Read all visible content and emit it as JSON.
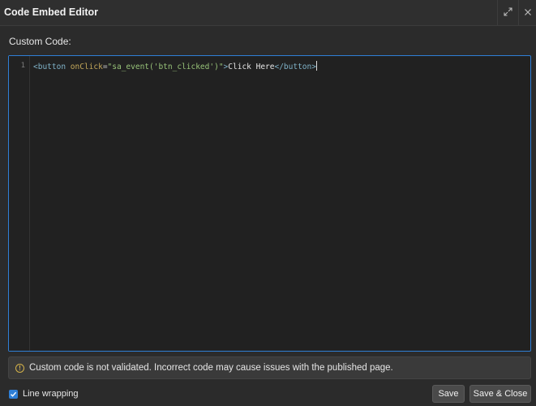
{
  "window": {
    "title": "Code Embed Editor",
    "expand_icon": "expand-icon",
    "close_icon": "close-icon"
  },
  "section": {
    "label": "Custom Code:"
  },
  "editor": {
    "line_number": "1",
    "tokens": {
      "t1": "<button",
      "t2": " onClick",
      "t3": "=",
      "t4": "\"sa_event('btn_clicked')\"",
      "t5": ">",
      "t6": "Click Here",
      "t7": "</button>"
    },
    "focus_color": "#2f7fd6"
  },
  "warning": {
    "icon": "info-icon",
    "text": "Custom code is not validated. Incorrect code may cause issues with the published page.",
    "icon_color": "#d4b24a"
  },
  "footer": {
    "line_wrapping_label": "Line wrapping",
    "line_wrapping_checked": true,
    "save_label": "Save",
    "save_close_label": "Save & Close"
  }
}
